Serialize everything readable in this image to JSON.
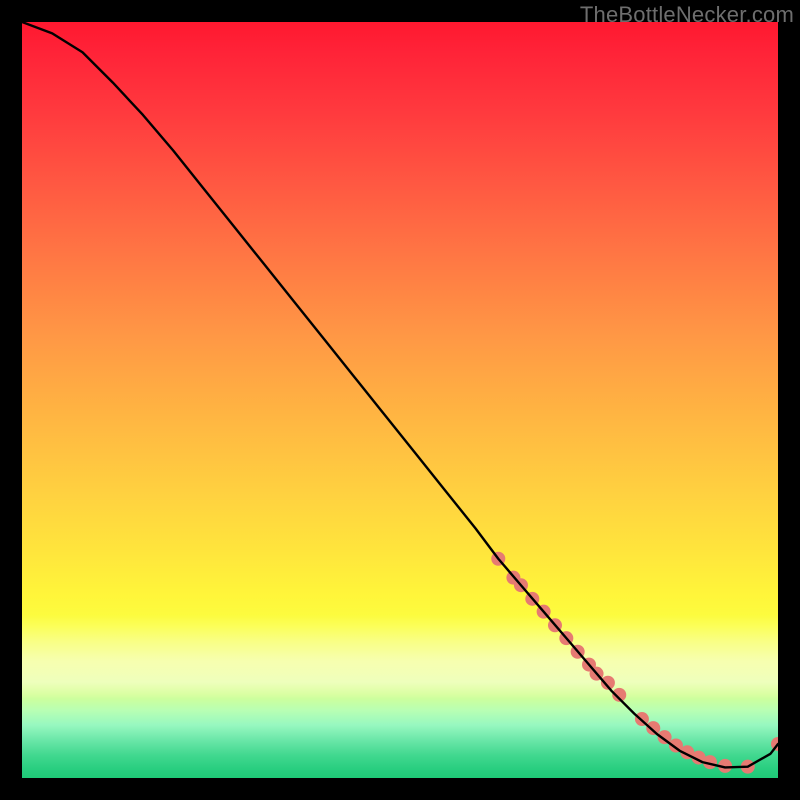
{
  "watermark": "TheBottleNecker.com",
  "chart_data": {
    "type": "line",
    "title": "",
    "xlabel": "",
    "ylabel": "",
    "xlim": [
      0,
      100
    ],
    "ylim": [
      0,
      100
    ],
    "axes_visible": false,
    "background": "vertical-gradient red→yellow→green",
    "series": [
      {
        "name": "bottleneck-curve",
        "color": "#000000",
        "x": [
          0,
          4,
          8,
          12,
          16,
          20,
          24,
          28,
          32,
          36,
          40,
          44,
          48,
          52,
          56,
          60,
          63,
          66,
          69,
          72,
          75,
          78,
          81,
          84,
          87,
          90,
          93,
          96,
          99,
          100
        ],
        "y": [
          100,
          98.5,
          96,
          92,
          87.7,
          83,
          78,
          73,
          68,
          63,
          58,
          53,
          48,
          43,
          38,
          33,
          29,
          25.5,
          22,
          18.5,
          15,
          11.5,
          8.5,
          5.8,
          3.6,
          2.1,
          1.4,
          1.5,
          3.2,
          4.5
        ]
      }
    ],
    "markers": {
      "name": "points-on-curve",
      "color": "#e67a72",
      "radius_px": 7,
      "x": [
        63,
        65,
        66,
        67.5,
        69,
        70.5,
        72,
        73.5,
        75,
        76,
        77.5,
        79,
        82,
        83.5,
        85,
        86.5,
        88,
        89.5,
        91,
        93,
        96,
        100
      ],
      "y": [
        29,
        26.5,
        25.5,
        23.7,
        22,
        20.2,
        18.5,
        16.7,
        15,
        13.8,
        12.6,
        11,
        7.8,
        6.6,
        5.4,
        4.3,
        3.4,
        2.7,
        2.1,
        1.6,
        1.5,
        4.5
      ]
    }
  }
}
